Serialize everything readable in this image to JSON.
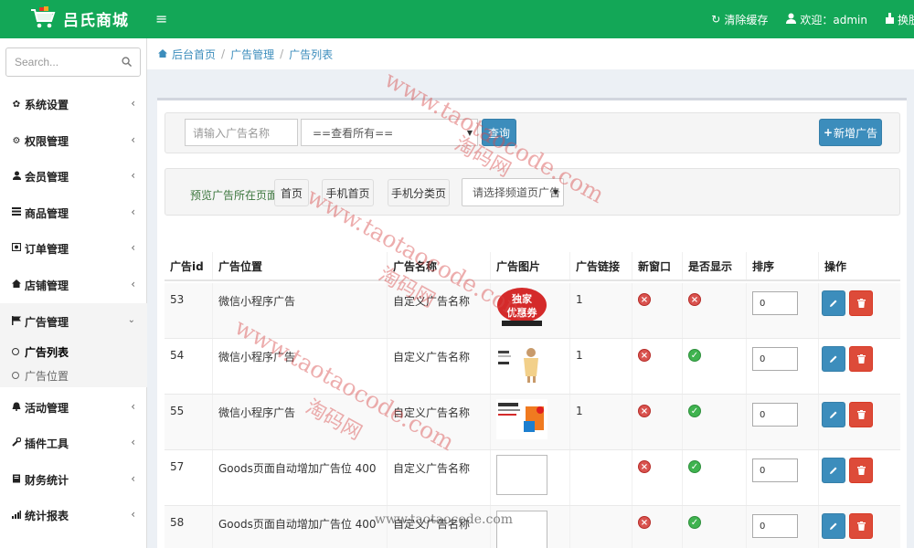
{
  "header": {
    "app_title": "吕氏商城",
    "menu_toggle_icon": "hamburger-icon",
    "clear_cache": "清除缓存",
    "welcome": "欢迎：admin",
    "switch_skin": "换肤",
    "brand_color": "#13a757"
  },
  "sidebar": {
    "search_placeholder": "Search...",
    "items": [
      {
        "label": "系统设置",
        "icon": "gear-icon"
      },
      {
        "label": "权限管理",
        "icon": "gears-icon"
      },
      {
        "label": "会员管理",
        "icon": "user-icon"
      },
      {
        "label": "商品管理",
        "icon": "list-icon"
      },
      {
        "label": "订单管理",
        "icon": "order-icon"
      },
      {
        "label": "店铺管理",
        "icon": "home-icon"
      },
      {
        "label": "广告管理",
        "icon": "flag-icon"
      },
      {
        "label": "活动管理",
        "icon": "bell-icon"
      },
      {
        "label": "插件工具",
        "icon": "wrench-icon"
      },
      {
        "label": "财务统计",
        "icon": "book-icon"
      },
      {
        "label": "统计报表",
        "icon": "bar-chart-icon"
      }
    ],
    "sub_items": [
      {
        "label": "广告列表"
      },
      {
        "label": "广告位置"
      }
    ]
  },
  "breadcrumb": {
    "home": "后台首页",
    "section": "广告管理",
    "current": "广告列表"
  },
  "filter": {
    "name_placeholder": "请输入广告名称",
    "view_select": "==查看所有==",
    "search_button": "查询",
    "add_button": "新增广告"
  },
  "preview": {
    "label": "预览广告所在页面:",
    "buttons": [
      "首页",
      "手机首页",
      "手机分类页"
    ],
    "channel_select": "请选择频道页广告"
  },
  "table": {
    "headers": [
      "广告id",
      "广告位置",
      "广告名称",
      "广告图片",
      "广告链接",
      "新窗口",
      "是否显示",
      "排序",
      "操作"
    ],
    "rows": [
      {
        "id": "53",
        "position": "微信小程序广告",
        "name": "自定义广告名称",
        "image": "独家优惠券",
        "link": "1",
        "new_window": "no",
        "visible": "no",
        "sort": "0"
      },
      {
        "id": "54",
        "position": "微信小程序广告",
        "name": "自定义广告名称",
        "image": "girl-promo",
        "link": "1",
        "new_window": "no",
        "visible": "yes",
        "sort": "0"
      },
      {
        "id": "55",
        "position": "微信小程序广告",
        "name": "自定义广告名称",
        "image": "tmall-promo",
        "link": "1",
        "new_window": "no",
        "visible": "yes",
        "sort": "0"
      },
      {
        "id": "57",
        "position": "Goods页面自动增加广告位 400",
        "name": "自定义广告名称",
        "image": "",
        "link": "",
        "new_window": "no",
        "visible": "yes",
        "sort": "0"
      },
      {
        "id": "58",
        "position": "Goods页面自动增加广告位 400",
        "name": "自定义广告名称",
        "image": "",
        "link": "",
        "new_window": "no",
        "visible": "yes",
        "sort": "0"
      }
    ]
  },
  "watermarks": [
    "www.taotaocode.com",
    "淘码网",
    "www.taotaocode.com",
    "淘码网",
    "www.taotaocode.com",
    "淘码网",
    "www.taotaocode.com"
  ]
}
